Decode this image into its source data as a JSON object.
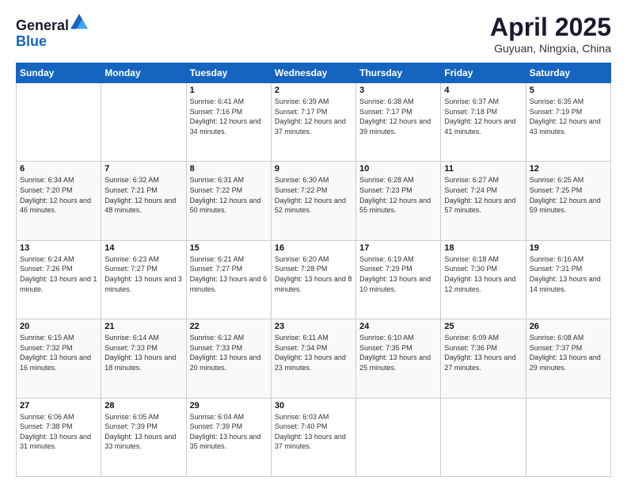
{
  "header": {
    "logo_general": "General",
    "logo_blue": "Blue",
    "month_title": "April 2025",
    "location": "Guyuan, Ningxia, China"
  },
  "days_of_week": [
    "Sunday",
    "Monday",
    "Tuesday",
    "Wednesday",
    "Thursday",
    "Friday",
    "Saturday"
  ],
  "weeks": [
    [
      {
        "day": "",
        "info": ""
      },
      {
        "day": "",
        "info": ""
      },
      {
        "day": "1",
        "info": "Sunrise: 6:41 AM\nSunset: 7:16 PM\nDaylight: 12 hours and 34 minutes."
      },
      {
        "day": "2",
        "info": "Sunrise: 6:39 AM\nSunset: 7:17 PM\nDaylight: 12 hours and 37 minutes."
      },
      {
        "day": "3",
        "info": "Sunrise: 6:38 AM\nSunset: 7:17 PM\nDaylight: 12 hours and 39 minutes."
      },
      {
        "day": "4",
        "info": "Sunrise: 6:37 AM\nSunset: 7:18 PM\nDaylight: 12 hours and 41 minutes."
      },
      {
        "day": "5",
        "info": "Sunrise: 6:35 AM\nSunset: 7:19 PM\nDaylight: 12 hours and 43 minutes."
      }
    ],
    [
      {
        "day": "6",
        "info": "Sunrise: 6:34 AM\nSunset: 7:20 PM\nDaylight: 12 hours and 46 minutes."
      },
      {
        "day": "7",
        "info": "Sunrise: 6:32 AM\nSunset: 7:21 PM\nDaylight: 12 hours and 48 minutes."
      },
      {
        "day": "8",
        "info": "Sunrise: 6:31 AM\nSunset: 7:22 PM\nDaylight: 12 hours and 50 minutes."
      },
      {
        "day": "9",
        "info": "Sunrise: 6:30 AM\nSunset: 7:22 PM\nDaylight: 12 hours and 52 minutes."
      },
      {
        "day": "10",
        "info": "Sunrise: 6:28 AM\nSunset: 7:23 PM\nDaylight: 12 hours and 55 minutes."
      },
      {
        "day": "11",
        "info": "Sunrise: 6:27 AM\nSunset: 7:24 PM\nDaylight: 12 hours and 57 minutes."
      },
      {
        "day": "12",
        "info": "Sunrise: 6:25 AM\nSunset: 7:25 PM\nDaylight: 12 hours and 59 minutes."
      }
    ],
    [
      {
        "day": "13",
        "info": "Sunrise: 6:24 AM\nSunset: 7:26 PM\nDaylight: 13 hours and 1 minute."
      },
      {
        "day": "14",
        "info": "Sunrise: 6:23 AM\nSunset: 7:27 PM\nDaylight: 13 hours and 3 minutes."
      },
      {
        "day": "15",
        "info": "Sunrise: 6:21 AM\nSunset: 7:27 PM\nDaylight: 13 hours and 6 minutes."
      },
      {
        "day": "16",
        "info": "Sunrise: 6:20 AM\nSunset: 7:28 PM\nDaylight: 13 hours and 8 minutes."
      },
      {
        "day": "17",
        "info": "Sunrise: 6:19 AM\nSunset: 7:29 PM\nDaylight: 13 hours and 10 minutes."
      },
      {
        "day": "18",
        "info": "Sunrise: 6:18 AM\nSunset: 7:30 PM\nDaylight: 13 hours and 12 minutes."
      },
      {
        "day": "19",
        "info": "Sunrise: 6:16 AM\nSunset: 7:31 PM\nDaylight: 13 hours and 14 minutes."
      }
    ],
    [
      {
        "day": "20",
        "info": "Sunrise: 6:15 AM\nSunset: 7:32 PM\nDaylight: 13 hours and 16 minutes."
      },
      {
        "day": "21",
        "info": "Sunrise: 6:14 AM\nSunset: 7:33 PM\nDaylight: 13 hours and 18 minutes."
      },
      {
        "day": "22",
        "info": "Sunrise: 6:12 AM\nSunset: 7:33 PM\nDaylight: 13 hours and 20 minutes."
      },
      {
        "day": "23",
        "info": "Sunrise: 6:11 AM\nSunset: 7:34 PM\nDaylight: 13 hours and 23 minutes."
      },
      {
        "day": "24",
        "info": "Sunrise: 6:10 AM\nSunset: 7:35 PM\nDaylight: 13 hours and 25 minutes."
      },
      {
        "day": "25",
        "info": "Sunrise: 6:09 AM\nSunset: 7:36 PM\nDaylight: 13 hours and 27 minutes."
      },
      {
        "day": "26",
        "info": "Sunrise: 6:08 AM\nSunset: 7:37 PM\nDaylight: 13 hours and 29 minutes."
      }
    ],
    [
      {
        "day": "27",
        "info": "Sunrise: 6:06 AM\nSunset: 7:38 PM\nDaylight: 13 hours and 31 minutes."
      },
      {
        "day": "28",
        "info": "Sunrise: 6:05 AM\nSunset: 7:39 PM\nDaylight: 13 hours and 33 minutes."
      },
      {
        "day": "29",
        "info": "Sunrise: 6:04 AM\nSunset: 7:39 PM\nDaylight: 13 hours and 35 minutes."
      },
      {
        "day": "30",
        "info": "Sunrise: 6:03 AM\nSunset: 7:40 PM\nDaylight: 13 hours and 37 minutes."
      },
      {
        "day": "",
        "info": ""
      },
      {
        "day": "",
        "info": ""
      },
      {
        "day": "",
        "info": ""
      }
    ]
  ]
}
